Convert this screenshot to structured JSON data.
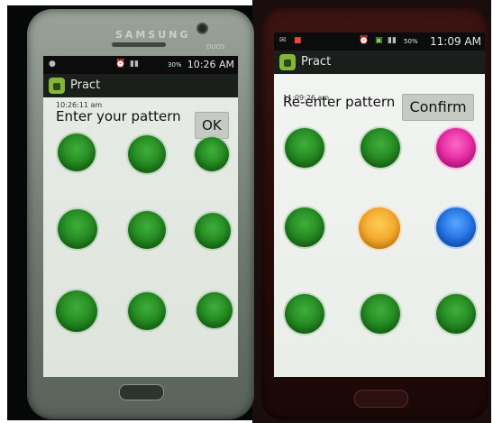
{
  "left_phone": {
    "brand": "SAMSUNG",
    "model": "DUOS",
    "status": {
      "time": "10:26 AM",
      "battery": "30%"
    },
    "app_title": "Pract",
    "overlay_time": "10:26:11 am",
    "prompt": "Enter your pattern",
    "button": "OK",
    "dots": [
      {
        "id": "1",
        "color": "green"
      },
      {
        "id": "2",
        "color": "green"
      },
      {
        "id": "3",
        "color": "green"
      },
      {
        "id": "4",
        "color": "green"
      },
      {
        "id": "5",
        "color": "green"
      },
      {
        "id": "6",
        "color": "green"
      },
      {
        "id": "7",
        "color": "green"
      },
      {
        "id": "8",
        "color": "green"
      },
      {
        "id": "9",
        "color": "green"
      }
    ]
  },
  "right_phone": {
    "status": {
      "time": "11:09 AM",
      "battery": "50%"
    },
    "app_title": "Pract",
    "overlay_time": "11:09:26 am",
    "prompt": "Re-enter pattern",
    "button": "Confirm",
    "dots": [
      {
        "id": "1",
        "color": "green"
      },
      {
        "id": "2",
        "color": "green"
      },
      {
        "id": "3",
        "color": "pink"
      },
      {
        "id": "4",
        "color": "green"
      },
      {
        "id": "5",
        "color": "orange"
      },
      {
        "id": "6",
        "color": "blue"
      },
      {
        "id": "7",
        "color": "green"
      },
      {
        "id": "8",
        "color": "green"
      },
      {
        "id": "9",
        "color": "green"
      }
    ]
  },
  "colors": {
    "green": "#22861f",
    "orange": "#f3a52a",
    "blue": "#1f6fe0",
    "pink": "#e2279f"
  }
}
